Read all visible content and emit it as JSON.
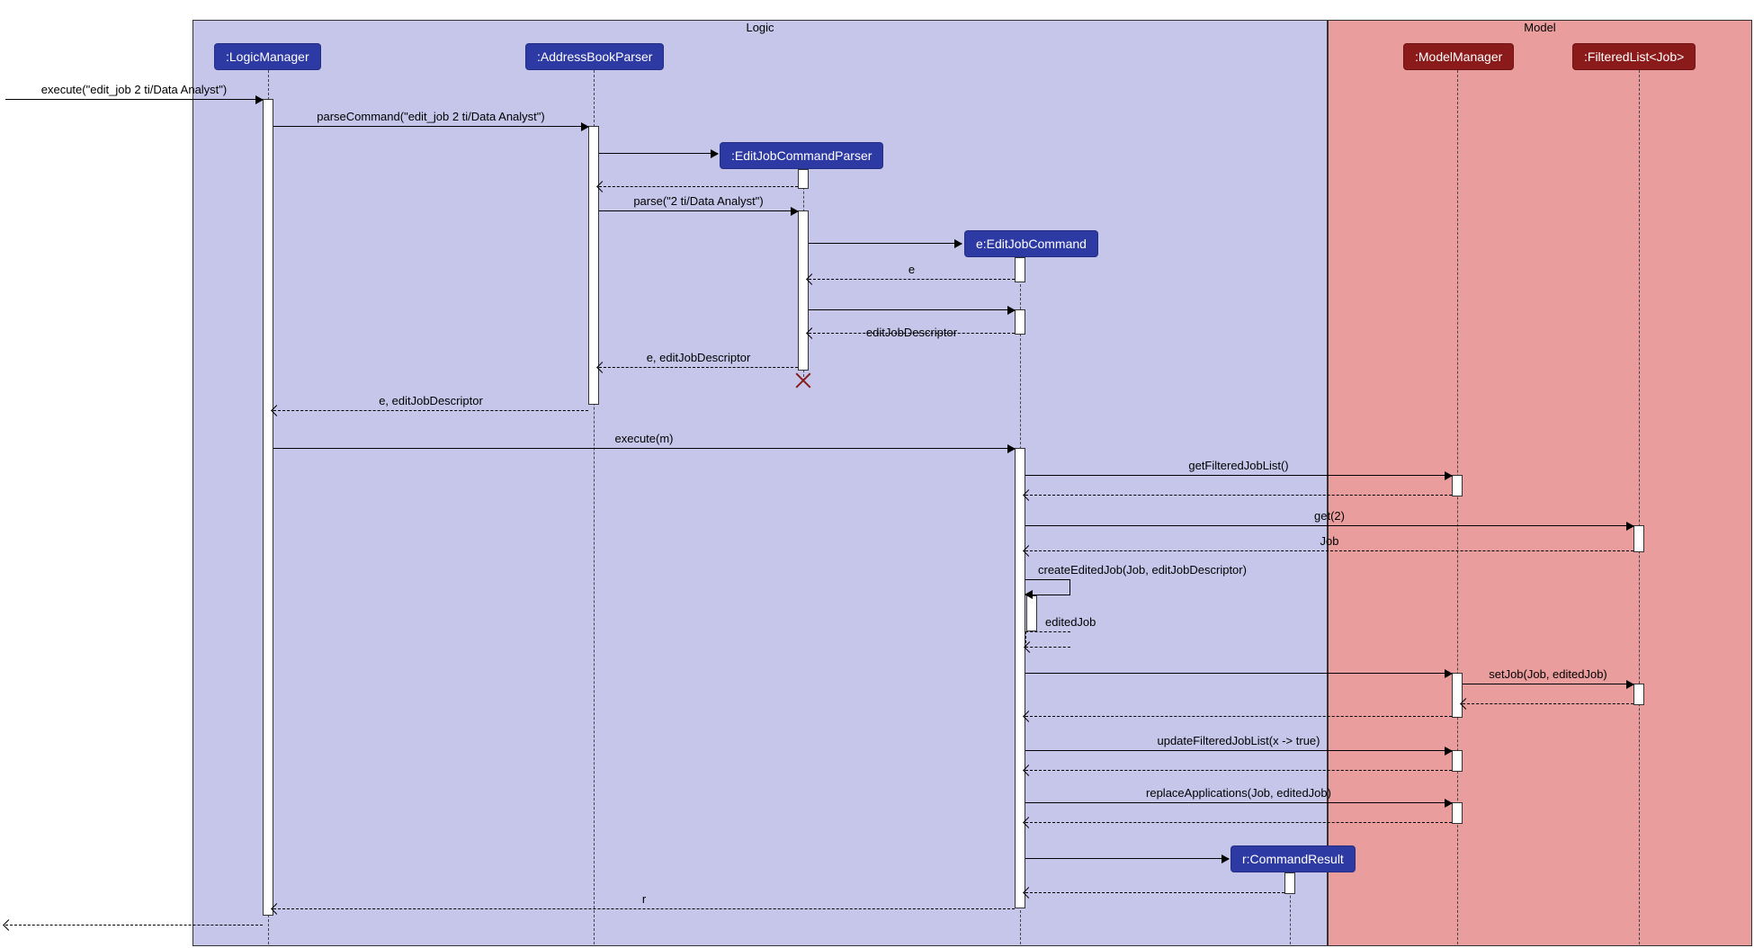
{
  "fragments": {
    "logic": {
      "label": "Logic"
    },
    "model": {
      "label": "Model"
    }
  },
  "participants": [
    {
      "id": "logicManager",
      "label": ":LogicManager",
      "style": "logic"
    },
    {
      "id": "addressBookParser",
      "label": ":AddressBookParser",
      "style": "logic"
    },
    {
      "id": "editJobCommandParser",
      "label": ":EditJobCommandParser",
      "style": "logic"
    },
    {
      "id": "editJobCommand",
      "label": "e:EditJobCommand",
      "style": "logic"
    },
    {
      "id": "commandResult",
      "label": "r:CommandResult",
      "style": "logic"
    },
    {
      "id": "modelManager",
      "label": ":ModelManager",
      "style": "model"
    },
    {
      "id": "filteredList",
      "label": ":FilteredList<Job>",
      "style": "model"
    }
  ],
  "messages": {
    "execute1": "execute(\"edit_job 2 ti/Data Analyst\")",
    "parseCommand": "parseCommand(\"edit_job 2 ti/Data Analyst\")",
    "parse": "parse(\"2 ti/Data Analyst\")",
    "e": "e",
    "editJobDescriptor": "editJobDescriptor",
    "eEditJobDescriptor": "e, editJobDescriptor",
    "executeM": "execute(m)",
    "getFilteredJobList": "getFilteredJobList()",
    "get2": "get(2)",
    "job": "Job",
    "createEditedJob": "createEditedJob(Job, editJobDescriptor)",
    "editedJob": "editedJob",
    "setJob": "setJob(Job, editedJob)",
    "updateFilteredJobList": "updateFilteredJobList(x -> true)",
    "replaceApplications": "replaceApplications(Job, editedJob)",
    "r": "r"
  }
}
